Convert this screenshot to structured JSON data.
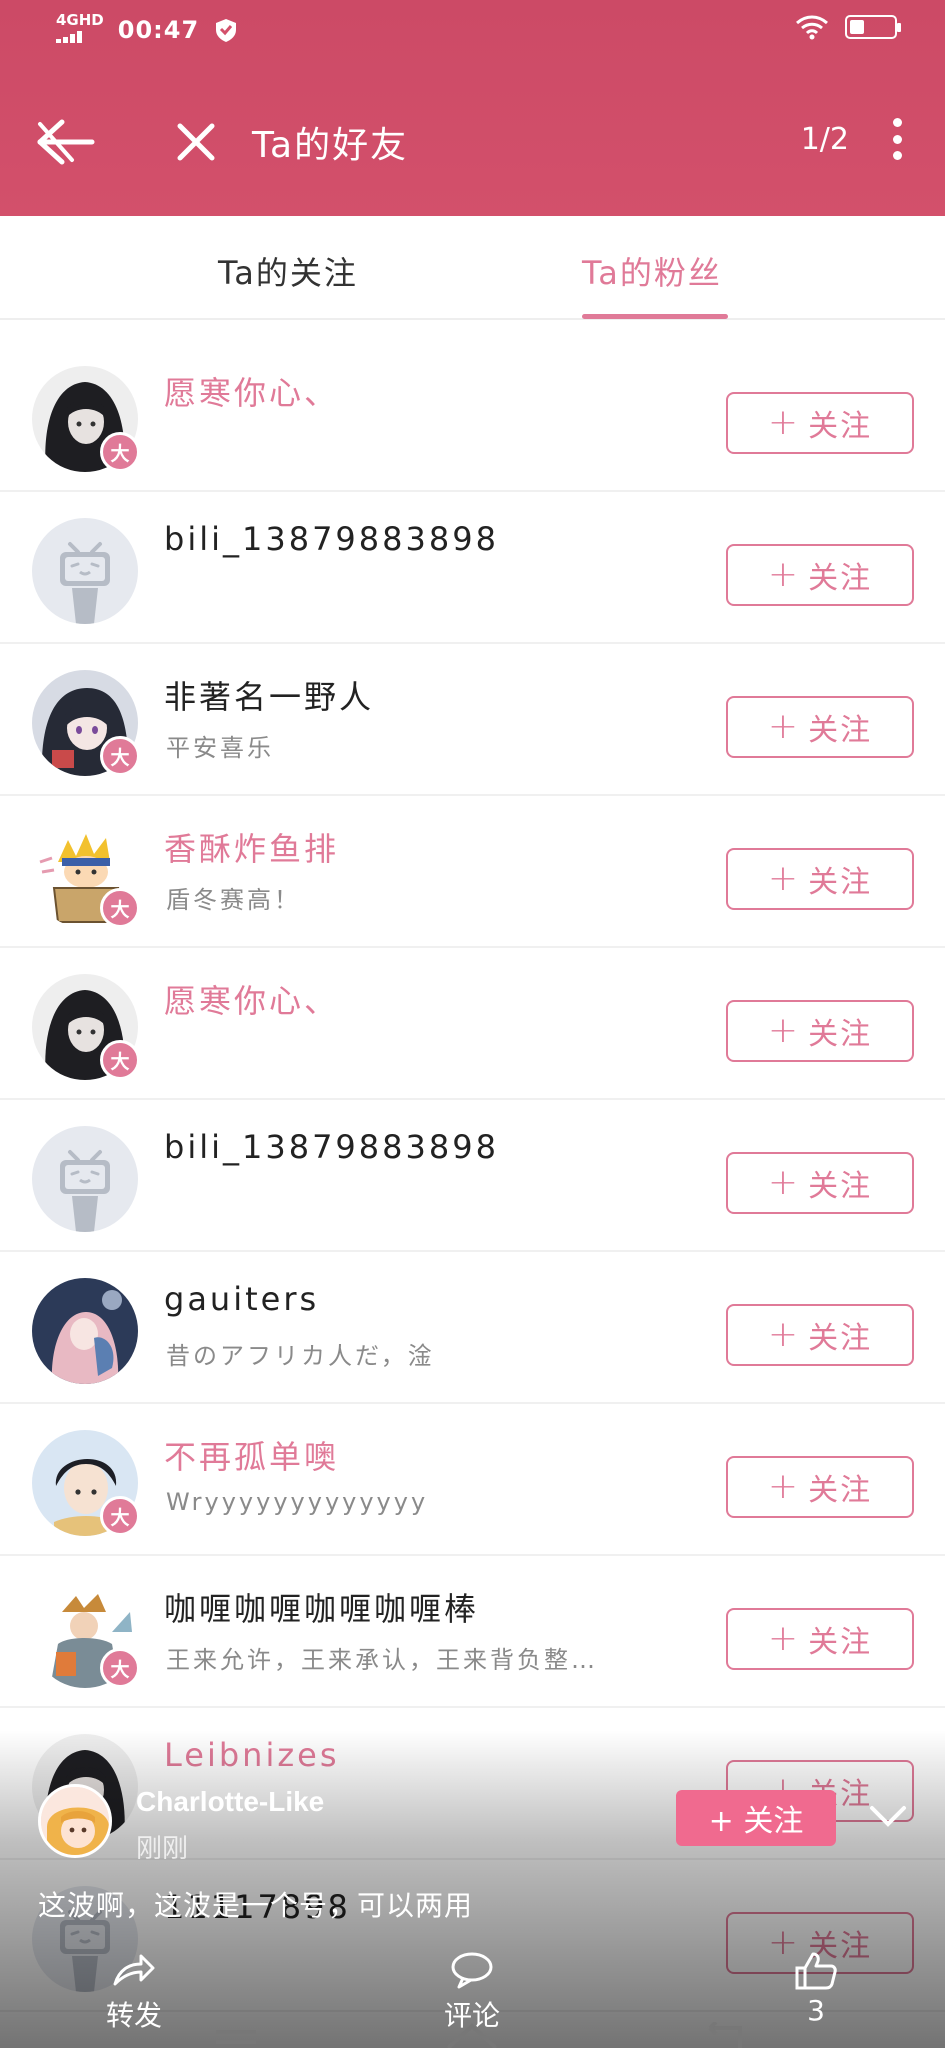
{
  "status_bar": {
    "network": "4GHD",
    "time": "00:47",
    "battery": "17"
  },
  "nav": {
    "title": "Ta的好友",
    "page_indicator": "1/2"
  },
  "tabs": [
    {
      "label": "Ta的关注",
      "active": false
    },
    {
      "label": "Ta的粉丝",
      "active": true
    }
  ],
  "follow_label": "关注",
  "users": [
    {
      "name": "愿寒你心、",
      "sign": "",
      "vip": true,
      "badge": "大",
      "avatar": "dark-hood"
    },
    {
      "name": "bili_13879883898",
      "sign": "",
      "vip": false,
      "badge": "",
      "avatar": "default-tv"
    },
    {
      "name": "非著名一野人",
      "sign": "平安喜乐",
      "vip": false,
      "badge": "大",
      "avatar": "anime-girl"
    },
    {
      "name": "香酥炸鱼排",
      "sign": "盾冬赛高！",
      "vip": true,
      "badge": "大",
      "avatar": "naruto"
    },
    {
      "name": "愿寒你心、",
      "sign": "",
      "vip": true,
      "badge": "大",
      "avatar": "dark-hood"
    },
    {
      "name": "bili_13879883898",
      "sign": "",
      "vip": false,
      "badge": "",
      "avatar": "default-tv"
    },
    {
      "name": "gauiters",
      "sign": "昔のアフリカ人だ，淦",
      "vip": false,
      "badge": "",
      "avatar": "illustration"
    },
    {
      "name": "不再孤单噢",
      "sign": "Wryyyyyyyyyyyyy",
      "vip": true,
      "badge": "大",
      "avatar": "anime-boy"
    },
    {
      "name": "咖喱咖喱咖喱咖喱棒",
      "sign": "王来允许，王来承认，王来背负整…",
      "vip": false,
      "badge": "大",
      "avatar": "warrior"
    },
    {
      "name": "Leibnizes",
      "sign": "",
      "vip": true,
      "badge": "",
      "avatar": "dark-hood"
    },
    {
      "name": "11117898",
      "sign": "",
      "vip": false,
      "badge": "",
      "avatar": "default-tv"
    }
  ],
  "overlay": {
    "username": "Charlotte-Like",
    "time": "刚刚",
    "follow": "+ 关注",
    "caption": "这波啊，这波是一个号，可以两用",
    "share_label": "转发",
    "comment_label": "评论",
    "like_count": "3"
  }
}
